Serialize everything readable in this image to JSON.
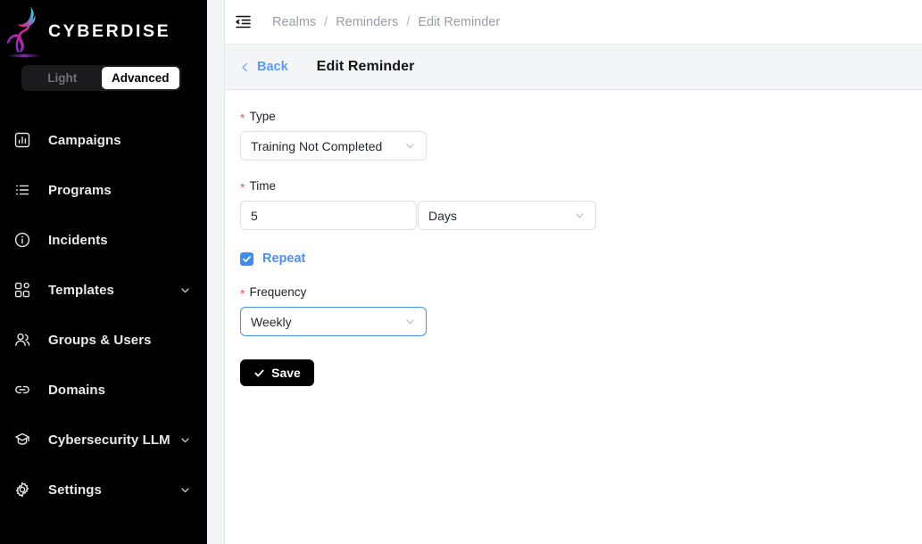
{
  "sidebar": {
    "brand": {
      "name": "CYBERDISE",
      "logo_icon": "antelope-logo-icon",
      "logo_gradient": [
        "#22d3ee",
        "#e0218a",
        "#8b2fd6"
      ]
    },
    "mode_toggle": {
      "options": [
        {
          "label": "Light",
          "active": false
        },
        {
          "label": "Advanced",
          "active": true
        }
      ]
    },
    "items": [
      {
        "label": "Campaigns",
        "icon": "chart-bar-icon",
        "expandable": false
      },
      {
        "label": "Programs",
        "icon": "list-icon",
        "expandable": false
      },
      {
        "label": "Incidents",
        "icon": "info-circle-icon",
        "expandable": false
      },
      {
        "label": "Templates",
        "icon": "blocks-icon",
        "expandable": true
      },
      {
        "label": "Groups & Users",
        "icon": "users-icon",
        "expandable": false
      },
      {
        "label": "Domains",
        "icon": "link-icon",
        "expandable": false
      },
      {
        "label": "Cybersecurity LLM",
        "icon": "graduation-cap-icon",
        "expandable": true
      },
      {
        "label": "Settings",
        "icon": "gear-icon",
        "expandable": true
      }
    ]
  },
  "topbar": {
    "collapse_icon": "collapse-sidebar-icon",
    "breadcrumb": [
      "Realms",
      "Reminders",
      "Edit Reminder"
    ],
    "breadcrumb_separator": "/"
  },
  "pagehead": {
    "back_label": "Back",
    "back_icon": "chevron-left-icon",
    "title": "Edit Reminder"
  },
  "form": {
    "type": {
      "label": "Type",
      "required": true,
      "value": "Training Not Completed",
      "caret_icon": "chevron-down-icon"
    },
    "time": {
      "label": "Time",
      "required": true,
      "amount": "5",
      "unit": "Days",
      "caret_icon": "chevron-down-icon"
    },
    "repeat": {
      "label": "Repeat",
      "checked": true,
      "check_icon": "check-icon"
    },
    "frequency": {
      "label": "Frequency",
      "required": true,
      "value": "Weekly",
      "focused": true,
      "caret_icon": "chevron-down-icon"
    },
    "save": {
      "label": "Save",
      "icon": "check-icon"
    },
    "required_marker": "*"
  },
  "colors": {
    "sidebar_bg": "#000000",
    "accent_blue": "#4a90f0",
    "required_red": "#f5544c",
    "header_bg": "#f4f5f7",
    "button_black": "#000000"
  }
}
